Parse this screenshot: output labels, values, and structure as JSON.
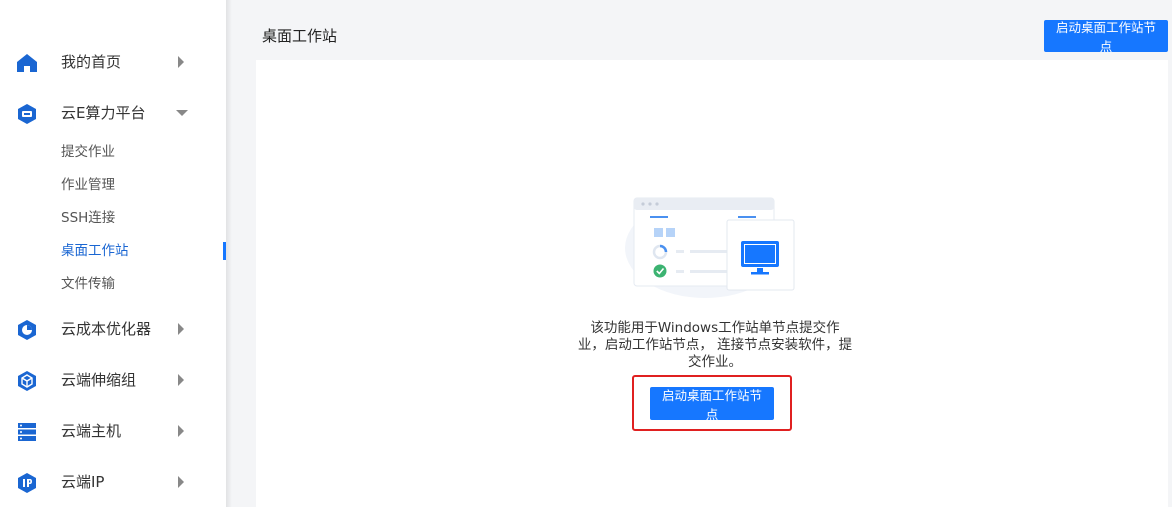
{
  "sidebar": {
    "items": [
      {
        "label": "我的首页",
        "icon": "home-icon",
        "arrow": "right"
      },
      {
        "label": "云E算力平台",
        "icon": "cloud-compute-icon",
        "arrow": "down",
        "children": [
          {
            "label": "提交作业"
          },
          {
            "label": "作业管理"
          },
          {
            "label": "SSH连接"
          },
          {
            "label": "桌面工作站",
            "active": true
          },
          {
            "label": "文件传输"
          }
        ]
      },
      {
        "label": "云成本优化器",
        "icon": "pie-chart-icon",
        "arrow": "right"
      },
      {
        "label": "云端伸缩组",
        "icon": "cube-icon",
        "arrow": "right"
      },
      {
        "label": "云端主机",
        "icon": "server-icon",
        "arrow": "right"
      },
      {
        "label": "云端IP",
        "icon": "ip-icon",
        "arrow": "right"
      }
    ]
  },
  "main": {
    "title": "桌面工作站",
    "top_button": "启动桌面工作站节点",
    "description": "该功能用于Windows工作站单节点提交作业，启动工作站节点， 连接节点安装软件，提交作业。",
    "center_button": "启动桌面工作站节点"
  },
  "colors": {
    "accent": "#1677ff",
    "highlight": "#e02020",
    "icon_blue": "#1a66d2"
  }
}
